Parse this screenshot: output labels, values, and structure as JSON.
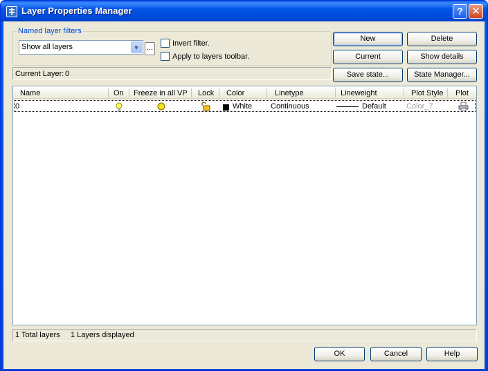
{
  "window": {
    "title": "Layer Properties Manager",
    "help_label": "?",
    "close_label": "✕"
  },
  "filters": {
    "group_label": "Named layer filters",
    "combo_value": "Show all layers",
    "ellipsis_label": "...",
    "invert_label": "Invert filter.",
    "invert_checked": false,
    "apply_label": "Apply to layers toolbar.",
    "apply_checked": false
  },
  "current_layer": {
    "label": "Current Layer:",
    "value": "0"
  },
  "buttons": {
    "new": "New",
    "delete": "Delete",
    "current": "Current",
    "show_details": "Show details",
    "save_state": "Save state...",
    "state_manager": "State Manager..."
  },
  "table": {
    "columns": [
      "Name",
      "On",
      "Freeze in all VP",
      "Lock",
      "Color",
      "Linetype",
      "Lineweight",
      "Plot Style",
      "Plot"
    ],
    "rows": [
      {
        "name": "0",
        "on_icon": "lightbulb-on-icon",
        "freeze_icon": "sun-thawed-icon",
        "lock_icon": "unlocked-padlock-icon",
        "color_swatch": "#000000",
        "color": "White",
        "linetype": "Continuous",
        "lineweight": "Default",
        "plot_style": "Color_7",
        "plot_icon": "printer-icon"
      }
    ]
  },
  "status": {
    "total": "1 Total layers",
    "displayed": "1 Layers displayed"
  },
  "footer": {
    "ok": "OK",
    "cancel": "Cancel",
    "help": "Help"
  },
  "colors": {
    "titlebar": "#0355e6",
    "dialog_bg": "#ece9d8",
    "group_label": "#0046d5",
    "plot_style_text": "#9f9f9f"
  }
}
